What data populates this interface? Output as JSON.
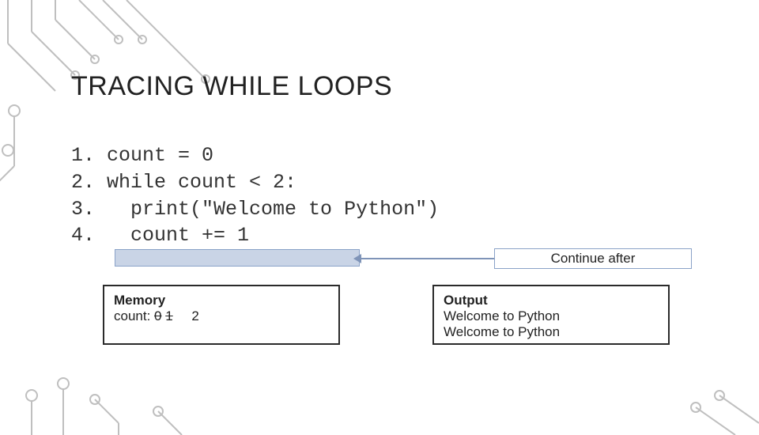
{
  "title": "TRACING WHILE LOOPS",
  "code": {
    "l1_num": "1.",
    "l1": " count = 0",
    "l2_num": "2.",
    "l2": " while count < 2:",
    "l3_num": "3.",
    "l3": "   print(\"Welcome to Python\")",
    "l4_num": "4.",
    "l4": "   count += 1"
  },
  "continue_label": "Continue after",
  "memory": {
    "title": "Memory",
    "var_label": "count:",
    "prev_values": [
      "0",
      "1"
    ],
    "current": "2"
  },
  "output": {
    "title": "Output",
    "lines": [
      "Welcome to Python",
      "Welcome to Python"
    ]
  },
  "chart_data": {
    "type": "table",
    "title": "While loop trace",
    "code_lines": [
      "count = 0",
      "while count < 2:",
      "    print(\"Welcome to Python\")",
      "    count += 1"
    ],
    "memory_trace": {
      "count": [
        0,
        1,
        2
      ]
    },
    "output_lines": [
      "Welcome to Python",
      "Welcome to Python"
    ]
  }
}
